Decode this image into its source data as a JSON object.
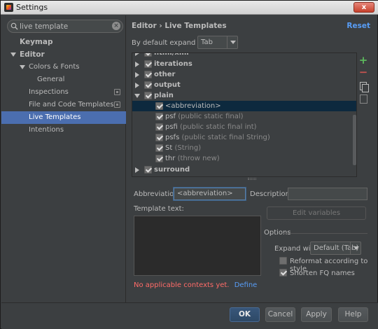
{
  "window": {
    "title": "Settings",
    "close_label": "x"
  },
  "sidebar": {
    "search_value": "live template",
    "items": [
      {
        "label": "Keymap"
      },
      {
        "label": "Editor"
      },
      {
        "label": "Colors & Fonts"
      },
      {
        "label": "General"
      },
      {
        "label": "Inspections"
      },
      {
        "label": "File and Code Templates"
      },
      {
        "label": "Live Templates"
      },
      {
        "label": "Intentions"
      }
    ]
  },
  "header": {
    "breadcrumb": "Editor › Live Templates",
    "reset_label": "Reset"
  },
  "expand": {
    "label": "By default expand with",
    "value": "Tab"
  },
  "templates": {
    "groups": [
      {
        "label": "html/xml"
      },
      {
        "label": "iterations"
      },
      {
        "label": "other"
      },
      {
        "label": "output"
      },
      {
        "label": "plain"
      },
      {
        "label": "surround"
      }
    ],
    "plain_items": [
      {
        "abbr": "<abbreviation>",
        "desc": ""
      },
      {
        "abbr": "psf",
        "desc": "(public static final)"
      },
      {
        "abbr": "psfi",
        "desc": "(public static final int)"
      },
      {
        "abbr": "psfs",
        "desc": "(public static final String)"
      },
      {
        "abbr": "St",
        "desc": "(String)"
      },
      {
        "abbr": "thr",
        "desc": "(throw new)"
      }
    ]
  },
  "editor": {
    "abbreviation_label": "Abbreviation:",
    "abbreviation_value": "<abbreviation>",
    "description_label": "Description:",
    "description_value": "",
    "template_text_label": "Template text:",
    "edit_variables_label": "Edit variables",
    "options_label": "Options",
    "expand_with_label": "Expand with",
    "expand_with_value": "Default (Tab)",
    "reformat_label": "Reformat according to style",
    "shorten_label": "Shorten FQ names",
    "error_text": "No applicable contexts yet.",
    "define_label": "Define"
  },
  "footer": {
    "ok": "OK",
    "cancel": "Cancel",
    "apply": "Apply",
    "help": "Help"
  }
}
